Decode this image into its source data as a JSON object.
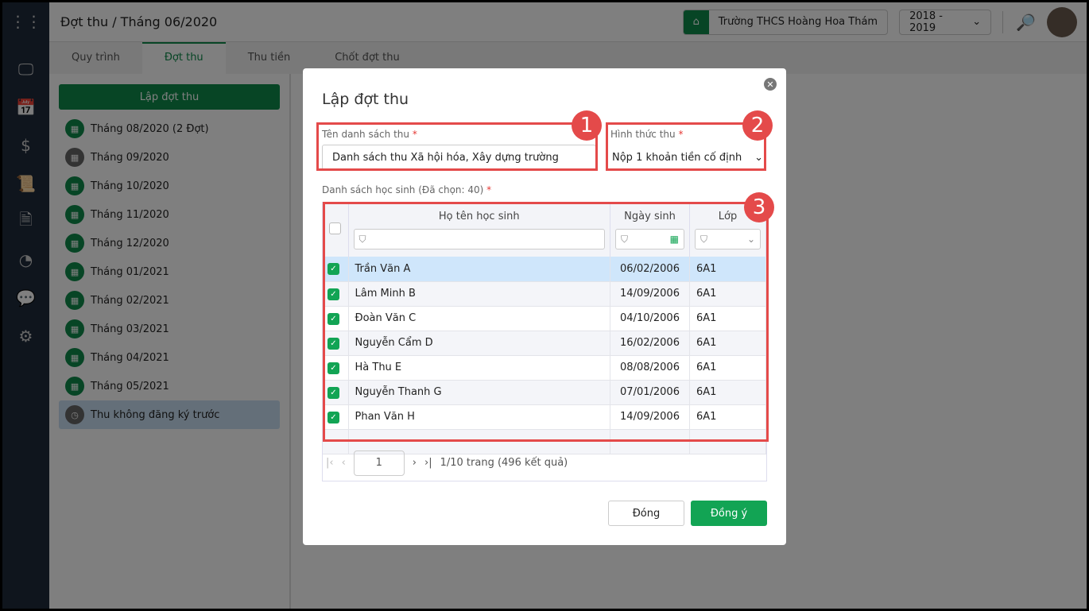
{
  "header": {
    "title": "Đợt thu / Tháng 06/2020",
    "school": "Trường THCS Hoàng Hoa Thám",
    "year": "2018 - 2019"
  },
  "tabs": [
    "Quy trình",
    "Đợt thu",
    "Thu tiền",
    "Chốt đợt thu"
  ],
  "sidebar": {
    "create_label": "Lập đợt thu",
    "items": [
      "Tháng 08/2020 (2 Đợt)",
      "Tháng 09/2020",
      "Tháng 10/2020",
      "Tháng 11/2020",
      "Tháng 12/2020",
      "Tháng 01/2021",
      "Tháng 02/2021",
      "Tháng 03/2021",
      "Tháng 04/2021",
      "Tháng 05/2021",
      "Thu không đăng ký trước"
    ]
  },
  "modal": {
    "title": "Lập đợt thu",
    "name_label": "Tên danh sách thu",
    "name_value": "Danh sách thu Xã hội hóa, Xây dựng trường",
    "method_label": "Hình thức thu",
    "method_value": "Nộp 1 khoản tiền cố định",
    "list_label": "Danh sách học sinh (Đã chọn: 40)",
    "required": "*",
    "columns": [
      "Họ tên học sinh",
      "Ngày sinh",
      "Lớp"
    ],
    "rows": [
      [
        "Trần Văn A",
        "06/02/2006",
        "6A1"
      ],
      [
        "Lâm Minh B",
        "14/09/2006",
        "6A1"
      ],
      [
        "Đoàn Văn C",
        "04/10/2006",
        "6A1"
      ],
      [
        "Nguyễn Cẩm D",
        "16/02/2006",
        "6A1"
      ],
      [
        "Hà Thu E",
        "08/08/2006",
        "6A1"
      ],
      [
        "Nguyễn Thanh G",
        "07/01/2006",
        "6A1"
      ],
      [
        "Phan Văn H",
        "14/09/2006",
        "6A1"
      ]
    ],
    "page": "1",
    "page_info": "1/10 trang (496 kết quả)",
    "close_label": "Đóng",
    "ok_label": "Đồng ý"
  },
  "annotations": [
    "1",
    "2",
    "3"
  ]
}
